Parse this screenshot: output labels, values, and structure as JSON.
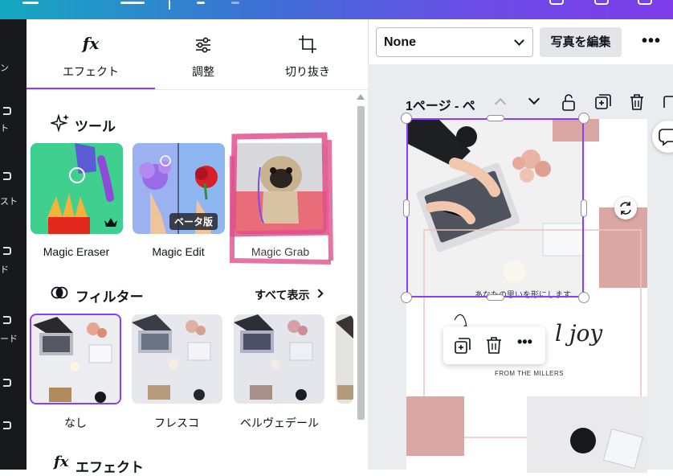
{
  "panel": {
    "tabs": [
      {
        "label": "エフェクト",
        "icon": "fx-icon"
      },
      {
        "label": "調整",
        "icon": "sliders-icon"
      },
      {
        "label": "切り抜き",
        "icon": "crop-icon"
      }
    ],
    "tools_section": {
      "title": "ツール",
      "items": [
        {
          "label": "Magic Eraser"
        },
        {
          "label": "Magic Edit",
          "badge": "ベータ版"
        },
        {
          "label": "Magic Grab"
        }
      ]
    },
    "filters_section": {
      "title": "フィルター",
      "see_all": "すべて表示",
      "items": [
        {
          "label": "なし",
          "selected": true
        },
        {
          "label": "フレスコ"
        },
        {
          "label": "ベルヴェデール"
        }
      ]
    },
    "effects_section": {
      "title": "エフェクト"
    }
  },
  "left_rail": {
    "items": [
      {
        "label": "ン"
      },
      {
        "label": "ト"
      },
      {
        "label": "スト"
      },
      {
        "label": "ド"
      },
      {
        "label": "ード"
      }
    ]
  },
  "workspace": {
    "select_value": "None",
    "edit_photo_label": "写真を編集",
    "page_label": "1ページ - ペ",
    "canvas_text": {
      "tagline": "あなたの思いを形にします",
      "script": "l joy",
      "from": "FROM THE MILLERS"
    }
  },
  "colors": {
    "accent": "#8b3dff",
    "rail": "#18191b",
    "pink": "#d79c9a"
  }
}
